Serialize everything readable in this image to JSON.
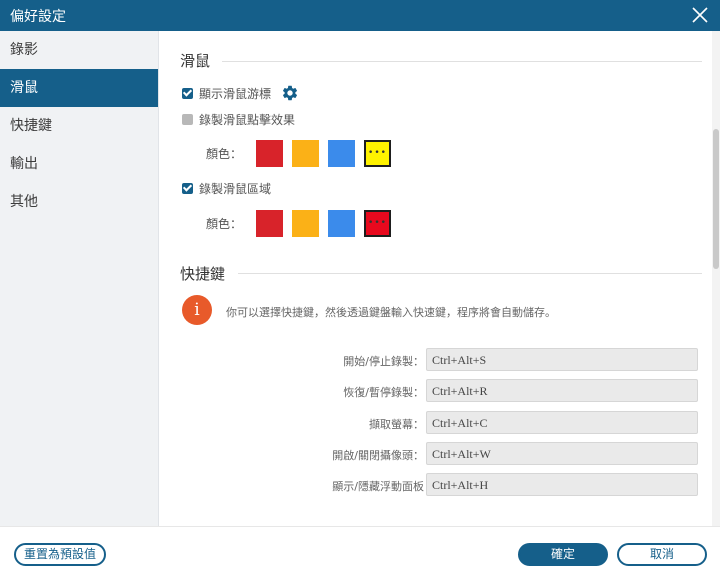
{
  "window": {
    "title": "偏好設定"
  },
  "sidebar": {
    "items": [
      {
        "label": "錄影"
      },
      {
        "label": "滑鼠"
      },
      {
        "label": "快捷鍵"
      },
      {
        "label": "輸出"
      },
      {
        "label": "其他"
      }
    ],
    "active_index": 1
  },
  "mouse": {
    "heading": "滑鼠",
    "show_cursor": {
      "label": "顯示滑鼠游標",
      "checked": true
    },
    "record_clicks": {
      "label": "錄製滑鼠點擊效果",
      "checked": false
    },
    "click_colors": {
      "label": "顏色：",
      "swatches": [
        "#d8232a",
        "#fbb117",
        "#3b8beb",
        "#fff200"
      ],
      "selected": 3
    },
    "record_area": {
      "label": "錄製滑鼠區域",
      "checked": true
    },
    "area_colors": {
      "label": "顏色：",
      "swatches": [
        "#d8232a",
        "#fbb117",
        "#3b8beb",
        "#e8091e"
      ],
      "selected": 3
    },
    "more_glyph": "•••"
  },
  "hotkeys": {
    "heading": "快捷鍵",
    "info_glyph": "i",
    "info": "你可以選擇快捷鍵，然後透過鍵盤輸入快速鍵，程序將會自動儲存。",
    "rows": [
      {
        "label": "開始/停止錄製：",
        "value": "Ctrl+Alt+S"
      },
      {
        "label": "恢復/暫停錄製：",
        "value": "Ctrl+Alt+R"
      },
      {
        "label": "擷取螢幕：",
        "value": "Ctrl+Alt+C"
      },
      {
        "label": "開啟/關閉攝像頭：",
        "value": "Ctrl+Alt+W"
      },
      {
        "label": "顯示/隱藏浮動面板",
        "value": "Ctrl+Alt+H"
      }
    ]
  },
  "footer": {
    "reset_label": "重置為預設值",
    "ok_label": "確定",
    "cancel_label": "取消"
  },
  "colors": {
    "accent": "#155f8a",
    "info": "#e85a2a"
  }
}
